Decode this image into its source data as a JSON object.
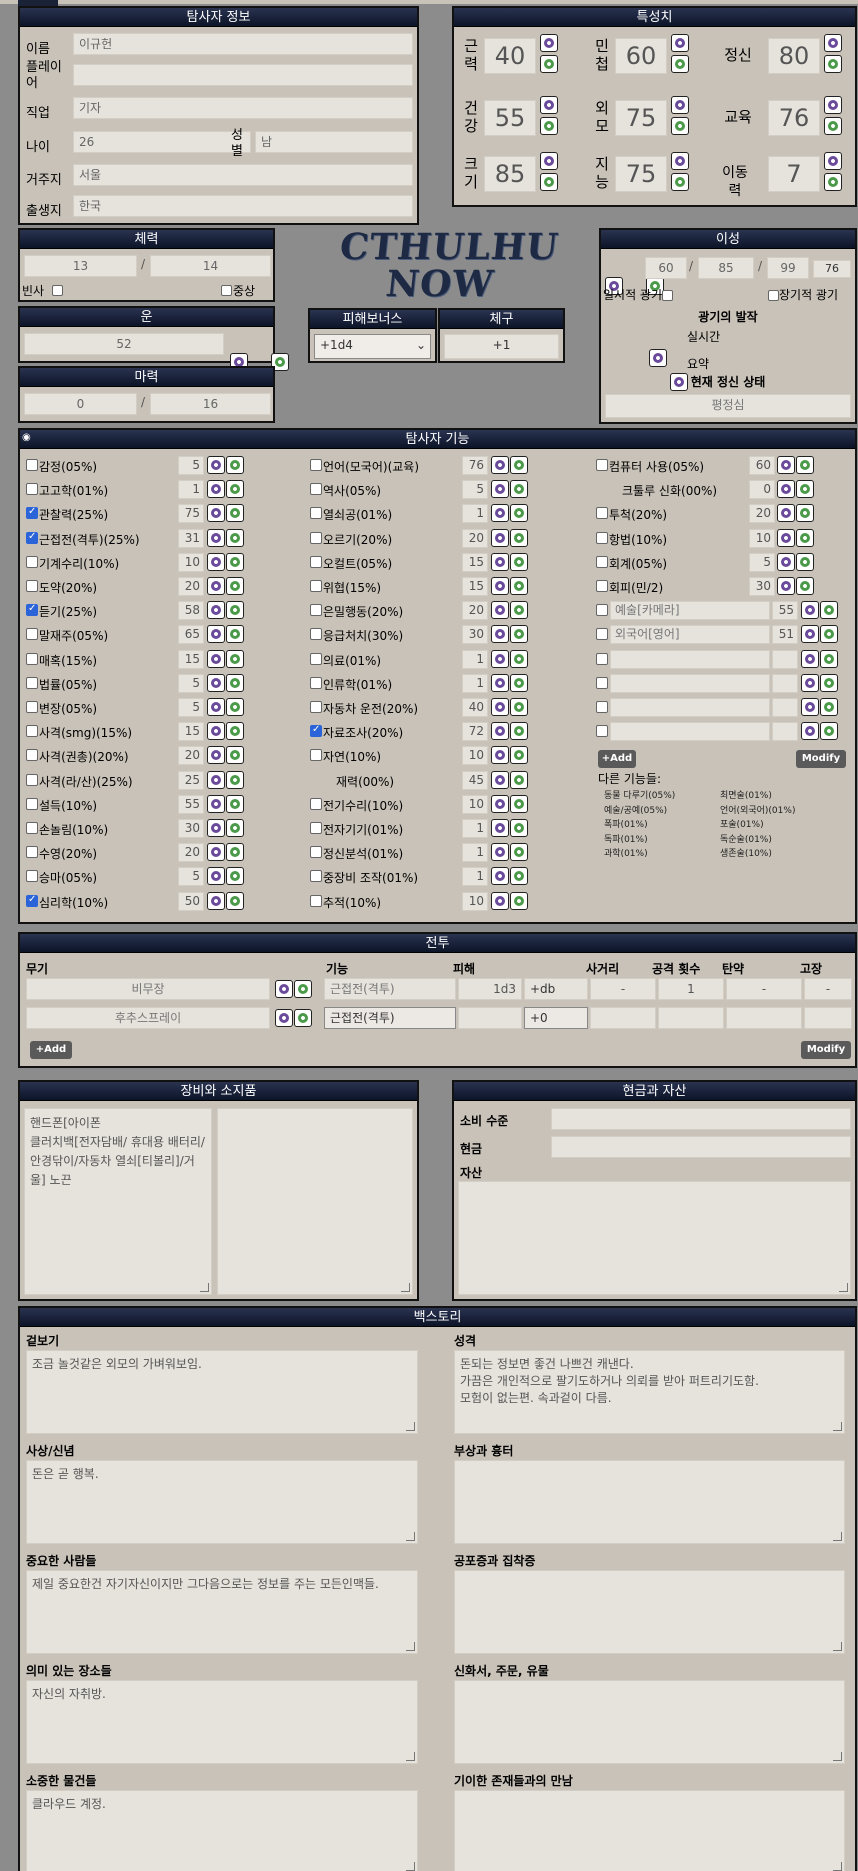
{
  "info": {
    "title": "탐사자 정보",
    "name_label": "이름",
    "name": "이규헌",
    "player_label": "플레이어",
    "player": "",
    "job_label": "직업",
    "job": "기자",
    "age_label": "나이",
    "age": "26",
    "sex_label": "성별",
    "sex": "남",
    "residence_label": "거주지",
    "residence": "서울",
    "birthplace_label": "출생지",
    "birthplace": "한국"
  },
  "chars": {
    "title": "특성치",
    "stats": [
      {
        "label": "근력",
        "value": "40"
      },
      {
        "label": "민첩",
        "value": "60"
      },
      {
        "label": "정신",
        "value": "80"
      },
      {
        "label": "건강",
        "value": "55"
      },
      {
        "label": "외모",
        "value": "75"
      },
      {
        "label": "교육",
        "value": "76"
      },
      {
        "label": "크기",
        "value": "85"
      },
      {
        "label": "지능",
        "value": "75"
      },
      {
        "label": "이동력",
        "value": "7"
      }
    ]
  },
  "hp": {
    "title": "체력",
    "current": "13",
    "max": "14",
    "dying_label": "빈사",
    "major_label": "중상"
  },
  "luck": {
    "title": "운",
    "value": "52"
  },
  "mp": {
    "title": "마력",
    "current": "0",
    "max": "16"
  },
  "logo": {
    "line1": "CTHULHU",
    "line2": "NOW"
  },
  "db": {
    "title": "피해보너스",
    "value": "+1d4"
  },
  "build": {
    "title": "체구",
    "value": "+1"
  },
  "sanity": {
    "title": "이성",
    "start": "60",
    "current": "85",
    "max": "99",
    "small": "76",
    "temp_label": "일시적 광기",
    "indef_label": "장기적 광기",
    "onset_label": "광기의 발작",
    "realtime_label": "실시간",
    "summary_label": "요약",
    "state_label": "현재 정신 상태",
    "state": "평정심"
  },
  "skills": {
    "title": "탐사자 기능",
    "col1": [
      {
        "name": "감정(05%)",
        "value": "5",
        "checked": false
      },
      {
        "name": "고고학(01%)",
        "value": "1",
        "checked": false
      },
      {
        "name": "관찰력(25%)",
        "value": "75",
        "checked": true
      },
      {
        "name": "근접전(격투)(25%)",
        "value": "31",
        "checked": true
      },
      {
        "name": "기계수리(10%)",
        "value": "10",
        "checked": false
      },
      {
        "name": "도약(20%)",
        "value": "20",
        "checked": false
      },
      {
        "name": "듣기(25%)",
        "value": "58",
        "checked": true
      },
      {
        "name": "말재주(05%)",
        "value": "65",
        "checked": false
      },
      {
        "name": "매혹(15%)",
        "value": "15",
        "checked": false
      },
      {
        "name": "법률(05%)",
        "value": "5",
        "checked": false
      },
      {
        "name": "변장(05%)",
        "value": "5",
        "checked": false
      },
      {
        "name": "사격(smg)(15%)",
        "value": "15",
        "checked": false
      },
      {
        "name": "사격(권총)(20%)",
        "value": "20",
        "checked": false
      },
      {
        "name": "사격(라/산)(25%)",
        "value": "25",
        "checked": false
      },
      {
        "name": "설득(10%)",
        "value": "55",
        "checked": false
      },
      {
        "name": "손놀림(10%)",
        "value": "30",
        "checked": false
      },
      {
        "name": "수영(20%)",
        "value": "20",
        "checked": false
      },
      {
        "name": "승마(05%)",
        "value": "5",
        "checked": false
      },
      {
        "name": "심리학(10%)",
        "value": "50",
        "checked": true
      }
    ],
    "col2": [
      {
        "name": "언어(모국어)(교육)",
        "value": "76",
        "checked": false
      },
      {
        "name": "역사(05%)",
        "value": "5",
        "checked": false
      },
      {
        "name": "열쇠공(01%)",
        "value": "1",
        "checked": false
      },
      {
        "name": "오르기(20%)",
        "value": "20",
        "checked": false
      },
      {
        "name": "오컬트(05%)",
        "value": "15",
        "checked": false
      },
      {
        "name": "위협(15%)",
        "value": "15",
        "checked": false
      },
      {
        "name": "은밀행동(20%)",
        "value": "20",
        "checked": false
      },
      {
        "name": "응급처치(30%)",
        "value": "30",
        "checked": false
      },
      {
        "name": "의료(01%)",
        "value": "1",
        "checked": false
      },
      {
        "name": "인류학(01%)",
        "value": "1",
        "checked": false
      },
      {
        "name": "자동차 운전(20%)",
        "value": "40",
        "checked": false
      },
      {
        "name": "자료조사(20%)",
        "value": "72",
        "checked": true
      },
      {
        "name": "자연(10%)",
        "value": "10",
        "checked": false
      },
      {
        "name": "재력(00%)",
        "value": "45",
        "checked": null
      },
      {
        "name": "전기수리(10%)",
        "value": "10",
        "checked": false
      },
      {
        "name": "전자기기(01%)",
        "value": "1",
        "checked": false
      },
      {
        "name": "정신분석(01%)",
        "value": "1",
        "checked": false
      },
      {
        "name": "중장비 조작(01%)",
        "value": "1",
        "checked": false
      },
      {
        "name": "추적(10%)",
        "value": "10",
        "checked": false
      }
    ],
    "col3": [
      {
        "name": "컴퓨터 사용(05%)",
        "value": "60",
        "checked": false
      },
      {
        "name": "크툴루 신화(00%)",
        "value": "0",
        "checked": null
      },
      {
        "name": "투척(20%)",
        "value": "20",
        "checked": false
      },
      {
        "name": "항법(10%)",
        "value": "10",
        "checked": false
      },
      {
        "name": "회계(05%)",
        "value": "5",
        "checked": false
      },
      {
        "name": "회피(민/2)",
        "value": "30",
        "checked": false
      }
    ],
    "custom": [
      {
        "name": "예술[카메라]",
        "value": "55"
      },
      {
        "name": "외국어[영어]",
        "value": "51"
      },
      {
        "name": "",
        "value": ""
      },
      {
        "name": "",
        "value": ""
      },
      {
        "name": "",
        "value": ""
      },
      {
        "name": "",
        "value": ""
      }
    ],
    "add_label": "+Add",
    "modify_label": "Modify",
    "other_label": "다른 기능들:",
    "other": [
      "동물 다루기(05%)",
      "최면술(01%)",
      "예술/공예(05%)",
      "언어(외국어)(01%)",
      "폭파(01%)",
      "포술(01%)",
      "독파(01%)",
      "독순술(01%)",
      "과학(01%)",
      "생존술(10%)"
    ]
  },
  "combat": {
    "title": "전투",
    "headers": [
      "무기",
      "기능",
      "피해",
      "사거리",
      "공격 횟수",
      "탄약",
      "고장"
    ],
    "rows": [
      {
        "weapon": "비무장",
        "skill": "근접전(격투)",
        "damage": "1d3",
        "db": "+db",
        "range": "-",
        "attacks": "1",
        "ammo": "-",
        "malf": "-"
      },
      {
        "weapon": "후추스프레이",
        "skill": "근접전(격투)",
        "damage": "",
        "db": "+0",
        "range": "",
        "attacks": "",
        "ammo": "",
        "malf": ""
      }
    ],
    "add_label": "+Add",
    "modify_label": "Modify"
  },
  "gear": {
    "title": "장비와 소지품",
    "left": "핸드폰[아이폰\n클러치백[전자담배/ 휴대용 배터리/안경닦이/자동차 열쇠[티볼리]/거울] 노끈",
    "right": ""
  },
  "cash": {
    "title": "현금과 자산",
    "spending_label": "소비 수준",
    "spending": "",
    "cash_label": "현금",
    "cash": "",
    "assets_label": "자산",
    "assets": ""
  },
  "backstory": {
    "title": "백스토리",
    "items": [
      {
        "label": "겉보기",
        "text": "조금 놀것같은 외모의 가벼워보임."
      },
      {
        "label": "성격",
        "text": "돈되는 정보면 좋건 나쁘건 캐낸다.\n가끔은 개인적으로 팔기도하거나 의뢰를 받아 퍼트리기도함.\n모험이 없는편. 속과겉이 다름."
      },
      {
        "label": "사상/신념",
        "text": "돈은 곧 행복."
      },
      {
        "label": "부상과 흉터",
        "text": ""
      },
      {
        "label": "중요한 사람들",
        "text": "제일 중요한건 자기자신이지만 그다음으로는 정보를 주는 모든인맥들."
      },
      {
        "label": "공포증과 집착증",
        "text": ""
      },
      {
        "label": "의미 있는 장소들",
        "text": "자신의 자취방."
      },
      {
        "label": "신화서, 주문, 유물",
        "text": ""
      },
      {
        "label": "소중한 물건들",
        "text": "클라우드 계정."
      },
      {
        "label": "기이한 존재들과의 만남",
        "text": ""
      }
    ]
  }
}
